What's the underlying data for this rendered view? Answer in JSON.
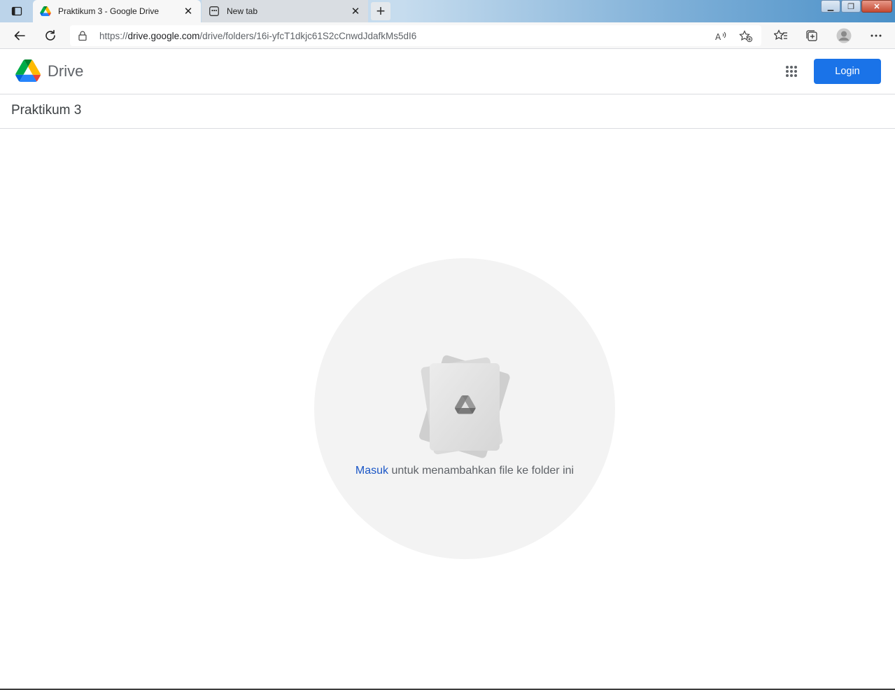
{
  "browser": {
    "tabs": [
      {
        "title": "Praktikum 3 - Google Drive",
        "active": true,
        "icon": "google-drive-icon"
      },
      {
        "title": "New tab",
        "active": false,
        "icon": "new-tab-page-icon"
      }
    ],
    "close_glyph": "✕",
    "new_tab_glyph": "+",
    "address": {
      "scheme": "https://",
      "host": "drive.google.com",
      "path": "/drive/folders/16i-yfcT1dkjc61S2cCnwdJdafkMs5dI6"
    },
    "window_controls": {
      "minimize": "▁",
      "restore": "❐",
      "close": "✕"
    }
  },
  "drive": {
    "app_name": "Drive",
    "login_label": "Login",
    "folder_title": "Praktikum 3",
    "empty_state": {
      "link_text": "Masuk",
      "message": " untuk menambahkan file ke folder ini"
    }
  },
  "colors": {
    "accent": "#1a73e8",
    "link": "#1a56c6",
    "text_secondary": "#5f6368",
    "empty_circle": "#f3f3f3"
  }
}
